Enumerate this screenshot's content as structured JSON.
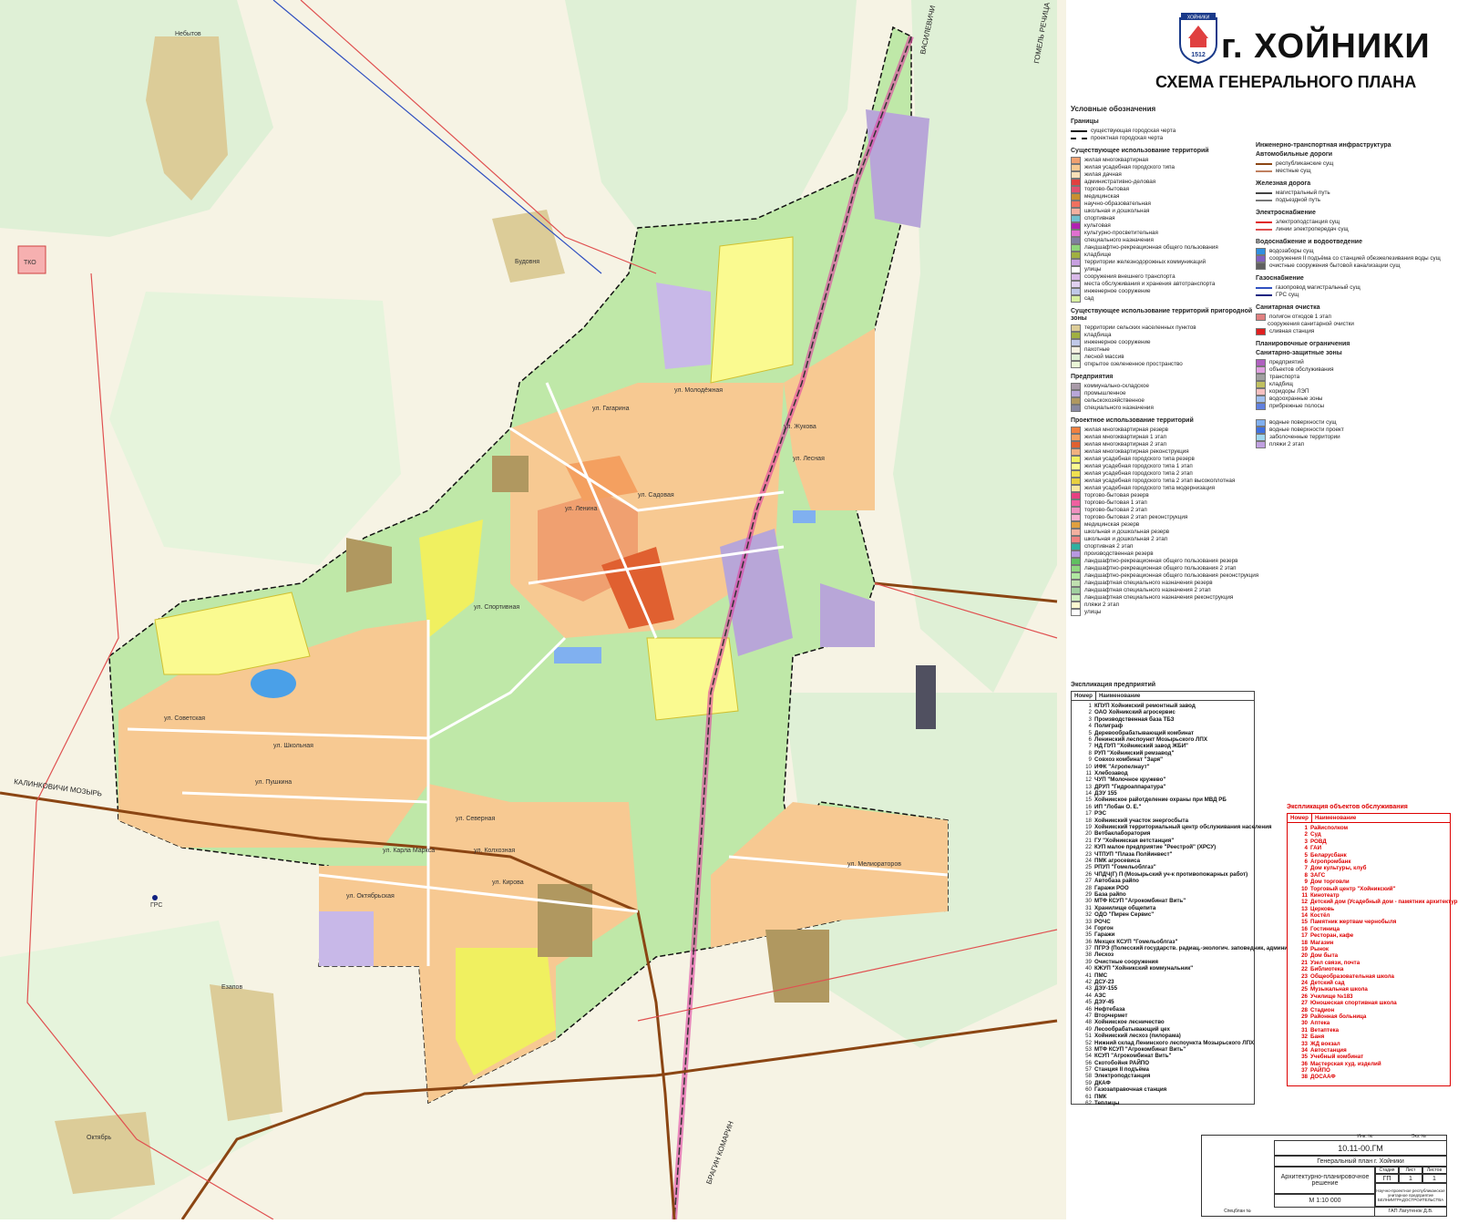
{
  "title": {
    "city": "г. ХОЙНИКИ",
    "subtitle": "СХЕМА ГЕНЕРАЛЬНОГО ПЛАНА",
    "emblem_year": "1512",
    "emblem_banner": "ХОЙНИКИ"
  },
  "colors": {
    "forest": "#dff0d6",
    "fields": "#f6f3e4",
    "park": "#8fd67a",
    "park_light": "#bfe8a8",
    "residential": "#f7c992",
    "multi": "#f0a070",
    "industrial": "#b8a6d8",
    "rail": "#e040a0",
    "road": "#8b4513",
    "power": "#e05050"
  },
  "map_labels": {
    "villages": [
      "Небытов",
      "Будовня",
      "Езапов",
      "Октябрь"
    ],
    "roads": [
      "ВАСИЛЕВИЧИ",
      "ГОМЕЛЬ РЕЧИЦА",
      "КАЛИНКОВИЧИ МОЗЫРЬ",
      "БРАГИН КОМАРИН"
    ],
    "misc": [
      "ГРС",
      "ТКО"
    ],
    "streets": [
      "ул. Советская",
      "ул. Ленина",
      "ул. Кирова",
      "ул. Карла Маркса",
      "ул. Октябрьская",
      "ул. Пушкина",
      "ул. Лесная",
      "ул. Спортивная",
      "ул. Школьная",
      "ул. Колхозная",
      "ул. Садовая",
      "ул. Гагарина",
      "ул. Молодёжная",
      "ул. Мелиораторов",
      "ул. Северная",
      "ул. Жукова"
    ]
  },
  "legend": {
    "heading": "Условные обозначения",
    "borders_title": "Границы",
    "borders": [
      {
        "label": "существующая городская черта",
        "style": "solid"
      },
      {
        "label": "проектная городская черта",
        "style": "dashdot"
      }
    ],
    "existing_title": "Существующее использование территорий",
    "existing": [
      {
        "label": "жилая многоквартирная",
        "color": "#f0a070"
      },
      {
        "label": "жилая усадебная городского типа",
        "color": "#f7c992"
      },
      {
        "label": "жилая дачная",
        "color": "#f9e0b8"
      },
      {
        "label": "административно-деловая",
        "color": "#e04040"
      },
      {
        "label": "торгово-бытовая",
        "color": "#e05070"
      },
      {
        "label": "медицинская",
        "color": "#c89030"
      },
      {
        "label": "научно-образовательная",
        "color": "#f07060"
      },
      {
        "label": "школьная и дошкольная",
        "color": "#f4b0a0"
      },
      {
        "label": "спортивная",
        "color": "#70c0d0"
      },
      {
        "label": "культовая",
        "color": "#b020b0"
      },
      {
        "label": "культурно-просветительная",
        "color": "#e070d0"
      },
      {
        "label": "специального назначения",
        "color": "#8080a0"
      },
      {
        "label": "ландшафтно-рекреационная общего пользования",
        "color": "#8fd67a"
      },
      {
        "label": "кладбище",
        "color": "#a0b040"
      },
      {
        "label": "территории железнодорожных коммуникаций",
        "color": "#c8a0e0"
      },
      {
        "label": "улицы",
        "color": "#ffffff"
      },
      {
        "label": "сооружения внешнего транспорта",
        "color": "#d8b8e8"
      },
      {
        "label": "места обслуживания и хранения автотранспорта",
        "color": "#e0d0f0"
      },
      {
        "label": "инженерное сооружение",
        "color": "#c0c8e8"
      },
      {
        "label": "сад",
        "color": "#d8f0a0"
      }
    ],
    "suburban_title": "Существующее использование территорий пригородной зоны",
    "suburban": [
      {
        "label": "территории сельских населенных пунктов",
        "color": "#dccc98"
      },
      {
        "label": "кладбища",
        "color": "#a0b040"
      },
      {
        "label": "инженерное сооружение",
        "color": "#c0c8e8"
      },
      {
        "label": "пахотные",
        "color": "#f6f3e4"
      },
      {
        "label": "лесной массив",
        "color": "#dff0d6"
      },
      {
        "label": "открытое озелененное пространство",
        "color": "#eaf6d6"
      }
    ],
    "enterprises_title": "Предприятия",
    "enterprises": [
      {
        "label": "коммунально-складское",
        "color": "#a89aa8"
      },
      {
        "label": "промышленное",
        "color": "#b8a6d8"
      },
      {
        "label": "сельскохозяйственное",
        "color": "#b09860"
      },
      {
        "label": "специального назначения",
        "color": "#8888a0"
      }
    ],
    "project_title": "Проектное использование территорий",
    "project": [
      {
        "label": "жилая многоквартирная резерв",
        "color": "#f08040"
      },
      {
        "label": "жилая многоквартирная 1 этап",
        "color": "#f4a060"
      },
      {
        "label": "жилая многоквартирная 2 этап",
        "color": "#e06030"
      },
      {
        "label": "жилая многоквартирная реконструкция",
        "color": "#f0b080"
      },
      {
        "label": "жилая усадебная городского типа резерв",
        "color": "#f0f060"
      },
      {
        "label": "жилая усадебная городского типа 1 этап",
        "color": "#fafa90"
      },
      {
        "label": "жилая усадебная городского типа 2 этап",
        "color": "#f0e050"
      },
      {
        "label": "жилая усадебная городского типа 2 этап высокоплотная",
        "color": "#e8d040"
      },
      {
        "label": "жилая усадебная городского типа модернизация",
        "color": "#f8e8a0"
      },
      {
        "label": "торгово-бытовая резерв",
        "color": "#e84080"
      },
      {
        "label": "торгово-бытовая 1 этап",
        "color": "#f060a0"
      },
      {
        "label": "торгово-бытовая 2 этап",
        "color": "#f090c0"
      },
      {
        "label": "торгово-бытовая 2 этап реконструкция",
        "color": "#f8b0d0"
      },
      {
        "label": "медицинская резерв",
        "color": "#e0a040"
      },
      {
        "label": "школьная и дошкольная резерв",
        "color": "#f4b0a0"
      },
      {
        "label": "школьная и дошкольная 2 этап",
        "color": "#f08080"
      },
      {
        "label": "спортивная 2 этап",
        "color": "#30b0a0"
      },
      {
        "label": "производственная резерв",
        "color": "#b898e0"
      },
      {
        "label": "ландшафтно-рекреационная общего пользования резерв",
        "color": "#60c060"
      },
      {
        "label": "ландшафтно-рекреационная общего пользования 2 этап",
        "color": "#90d880"
      },
      {
        "label": "ландшафтно-рекреационная общего пользования реконструкция",
        "color": "#b0e8a0"
      },
      {
        "label": "ландшафтная специального назначения резерв",
        "color": "#c0e0b0"
      },
      {
        "label": "ландшафтная специального назначения 2 этап",
        "color": "#a0d0a0"
      },
      {
        "label": "ландшафтная специального назначения реконструкция",
        "color": "#d0f0c0"
      },
      {
        "label": "пляжи 2 этап",
        "color": "#fff8d0"
      },
      {
        "label": "улицы",
        "color": "#ffffff"
      }
    ],
    "infra_title": "Инженерно-транспортная инфраструктура",
    "roads_title": "Автомобильные дороги",
    "roads": [
      {
        "label": "республиканские сущ",
        "color": "#8b4513"
      },
      {
        "label": "местные сущ",
        "color": "#c08060"
      }
    ],
    "rail_title": "Железная дорога",
    "rail": [
      {
        "label": "магистральный путь",
        "color": "#444444"
      },
      {
        "label": "подъездной путь",
        "color": "#777777"
      }
    ],
    "power_title": "Электроснабжение",
    "power": [
      {
        "label": "электроподстанция сущ",
        "color": "#e02020"
      },
      {
        "label": "линии электропередач сущ",
        "color": "#e05050"
      }
    ],
    "water_title": "Водоснабжение и водоотведение",
    "water": [
      {
        "label": "водозаборы сущ",
        "color": "#3090e0"
      },
      {
        "label": "сооружения II подъёма со станцией обезжелезивания воды сущ",
        "color": "#8060c0"
      },
      {
        "label": "очистные сооружения бытовой канализации сущ",
        "color": "#606060"
      }
    ],
    "gas_title": "Газоснабжение",
    "gas": [
      {
        "label": "газопровод магистральный сущ",
        "color": "#3050c0"
      },
      {
        "label": "ГРС сущ",
        "color": "#102080"
      }
    ],
    "sanitary_title": "Санитарная очистка",
    "sanitary": [
      {
        "label": "полигон отходов 1 этап",
        "color": "#e08080"
      },
      {
        "label": "сооружения санитарной очистки",
        "color": ""
      },
      {
        "label": "сливная станция",
        "color": "#e02020"
      }
    ],
    "planning_title": "Планировочные ограничения",
    "sanitary_zones_title": "Санитарно-защитные зоны",
    "planning": [
      {
        "label": "предприятий",
        "color": "#b060c0"
      },
      {
        "label": "объектов обслуживания",
        "color": "#e0a0e0"
      },
      {
        "label": "транспорта",
        "color": "#a0a0a0"
      },
      {
        "label": "кладбищ",
        "color": "#c0c060"
      },
      {
        "label": "коридоры ЛЭП",
        "color": "#f8c0c0"
      },
      {
        "label": "водоохранные зоны",
        "color": "#a0c0f0"
      },
      {
        "label": "прибрежные полосы",
        "color": "#6080e0"
      }
    ],
    "surfaces": [
      {
        "label": "водные поверхности сущ",
        "color": "#80b0f0"
      },
      {
        "label": "водные поверхности проект",
        "color": "#4070e0"
      },
      {
        "label": "заболоченные территории",
        "color": "#a0d8f0"
      },
      {
        "label": "пляжи 2 этап",
        "color": "#c0a0e0"
      }
    ]
  },
  "enterprises_table": {
    "title": "Экспликация предприятий",
    "col_num": "Номер",
    "col_name": "Наименование",
    "rows": [
      [
        "1",
        "КПУП Хойникский ремонтный завод"
      ],
      [
        "2",
        "ОАО Хойникский агросервис"
      ],
      [
        "3",
        "Производственная база ТБЗ"
      ],
      [
        "4",
        "Полиграф"
      ],
      [
        "5",
        "Деревообрабатывающий комбинат"
      ],
      [
        "6",
        "Ленинский леспоункт Мозырьского ЛПХ"
      ],
      [
        "7",
        "НД ПУП \"Хойникский завод ЖБИ\""
      ],
      [
        "8",
        "РУП \"Хойникский ремзавод\""
      ],
      [
        "9",
        "Совхоз комбинат \"Заря\""
      ],
      [
        "10",
        "ИФК \"Агропелнаут\""
      ],
      [
        "11",
        "Хлебозавод"
      ],
      [
        "12",
        "ЧУП \"Молочное кружево\""
      ],
      [
        "13",
        "ДРУП \"Гидроаппаратура\""
      ],
      [
        "14",
        "ДЭУ 155"
      ],
      [
        "15",
        "Хойникское райотделение охраны при МВД РБ"
      ],
      [
        "16",
        "ИП \"Лобан О. Е.\""
      ],
      [
        "17",
        "РЭС"
      ],
      [
        "18",
        "Хойникский участок энергосбыта"
      ],
      [
        "19",
        "Хойникский территориальный центр обслуживания населения"
      ],
      [
        "20",
        "Ветбаклаборатория"
      ],
      [
        "21",
        "ГУ \"Хойникская ветстанция\""
      ],
      [
        "22",
        "КУП малое предприятие \"Реестрой\" (ХРСУ)"
      ],
      [
        "23",
        "ЧТПУП \"Плаза Полйинвест\""
      ],
      [
        "24",
        "ПМК агросевиса"
      ],
      [
        "25",
        "РПУП \"Гомельоблгаз\""
      ],
      [
        "26",
        "ЧПДЧ(Г) П (Мозырьский уч-к противопожарных работ)"
      ],
      [
        "27",
        "Автобаза райпо"
      ],
      [
        "28",
        "Гаражи РОО"
      ],
      [
        "29",
        "База райпо"
      ],
      [
        "30",
        "МТФ КСУП \"Агрокомбинат Вить\""
      ],
      [
        "31",
        "Хранилище общепита"
      ],
      [
        "32",
        "ОДО \"Пирен Сервис\""
      ],
      [
        "33",
        "РОЧС"
      ],
      [
        "34",
        "Горгон"
      ],
      [
        "35",
        "Гаражи"
      ],
      [
        "36",
        "Мехцех КСУП \"Гомельоблгаз\""
      ],
      [
        "37",
        "ПГРЭ (Полесский государств. радиац.-экологич. заповедник, администр.)"
      ],
      [
        "38",
        "Лесхоз"
      ],
      [
        "39",
        "Очистные сооружения"
      ],
      [
        "40",
        "КЖУП \"Хойникский коммунальник\""
      ],
      [
        "41",
        "ПМС"
      ],
      [
        "42",
        "ДСУ-23"
      ],
      [
        "43",
        "ДЭУ-155"
      ],
      [
        "44",
        "АЗС"
      ],
      [
        "45",
        "ДЭУ-45"
      ],
      [
        "46",
        "Нефтебаза"
      ],
      [
        "47",
        "Вторчермет"
      ],
      [
        "48",
        "Хойникское лесничество"
      ],
      [
        "49",
        "Лесообрабатывающий цех"
      ],
      [
        "51",
        "Хойникский лесхоз (пилорама)"
      ],
      [
        "52",
        "Нижний склад Ленинского леспоункта Мозырьского ЛПХ"
      ],
      [
        "53",
        "МТФ КСУП \"Агрокомбинат Вить\""
      ],
      [
        "54",
        "КСУП \"Агрокомбинат Вить\""
      ],
      [
        "56",
        "Скотобойня РАЙПО"
      ],
      [
        "57",
        "Станция II подъёма"
      ],
      [
        "58",
        "Электроподстанция"
      ],
      [
        "59",
        "ДКАФ"
      ],
      [
        "60",
        "Газозаправочная станция"
      ],
      [
        "61",
        "ПМК"
      ],
      [
        "62",
        "Теплицы"
      ]
    ]
  },
  "services_table": {
    "title": "Экспликация объектов обслуживания",
    "col_num": "Номер",
    "col_name": "Наименование",
    "rows": [
      [
        "1",
        "Райисполком"
      ],
      [
        "2",
        "Суд"
      ],
      [
        "3",
        "РОВД"
      ],
      [
        "4",
        "ГАИ"
      ],
      [
        "5",
        "Беларусбанк"
      ],
      [
        "6",
        "Агропромбанк"
      ],
      [
        "7",
        "Дом культуры, клуб"
      ],
      [
        "8",
        "ЗАГС"
      ],
      [
        "9",
        "Дом торговли"
      ],
      [
        "10",
        "Торговый центр \"Хойникский\""
      ],
      [
        "11",
        "Кинотеатр"
      ],
      [
        "12",
        "Детский дом (Усадебный дом - памятник архитектуры)"
      ],
      [
        "13",
        "Церковь"
      ],
      [
        "14",
        "Костёл"
      ],
      [
        "15",
        "Памятник жертвам чернобыля"
      ],
      [
        "16",
        "Гостиница"
      ],
      [
        "17",
        "Ресторан, кафе"
      ],
      [
        "18",
        "Магазин"
      ],
      [
        "19",
        "Рынок"
      ],
      [
        "20",
        "Дом быта"
      ],
      [
        "21",
        "Узел связи, почта"
      ],
      [
        "22",
        "Библиотека"
      ],
      [
        "23",
        "Общеобразовательная школа"
      ],
      [
        "24",
        "Детский сад"
      ],
      [
        "25",
        "Музыкальная школа"
      ],
      [
        "26",
        "Училище №183"
      ],
      [
        "27",
        "Юношеская спортивная школа"
      ],
      [
        "28",
        "Стадион"
      ],
      [
        "29",
        "Районная больница"
      ],
      [
        "30",
        "Аптека"
      ],
      [
        "31",
        "Ветаптека"
      ],
      [
        "32",
        "Баня"
      ],
      [
        "33",
        "ЖД вокзал"
      ],
      [
        "34",
        "Автостанция"
      ],
      [
        "35",
        "Учебный комбинат"
      ],
      [
        "36",
        "Мастерская худ. изделий"
      ],
      [
        "37",
        "РАЙПО"
      ],
      [
        "38",
        "ДОСААФ"
      ]
    ]
  },
  "stamp": {
    "code": "10.11-00.ГМ",
    "inv": "Инв. №",
    "copy": "Экз. №",
    "project": "Генеральный план г. Хойники",
    "section": "Архитектурно-планировочное решение",
    "stage_h": "Стадия",
    "sheet_h": "Лист",
    "sheets_h": "Листов",
    "stage": "ГП",
    "sheet": "1",
    "sheets": "1",
    "org": "Научно-проектное республиканское унитарное предприятие БЕЛНИИГРАДОСТРОИТЕЛЬСТВА",
    "scale": "М 1:10 000",
    "author": "ГАП Лагутенок Д.В.",
    "spec": "Спецблан №"
  }
}
